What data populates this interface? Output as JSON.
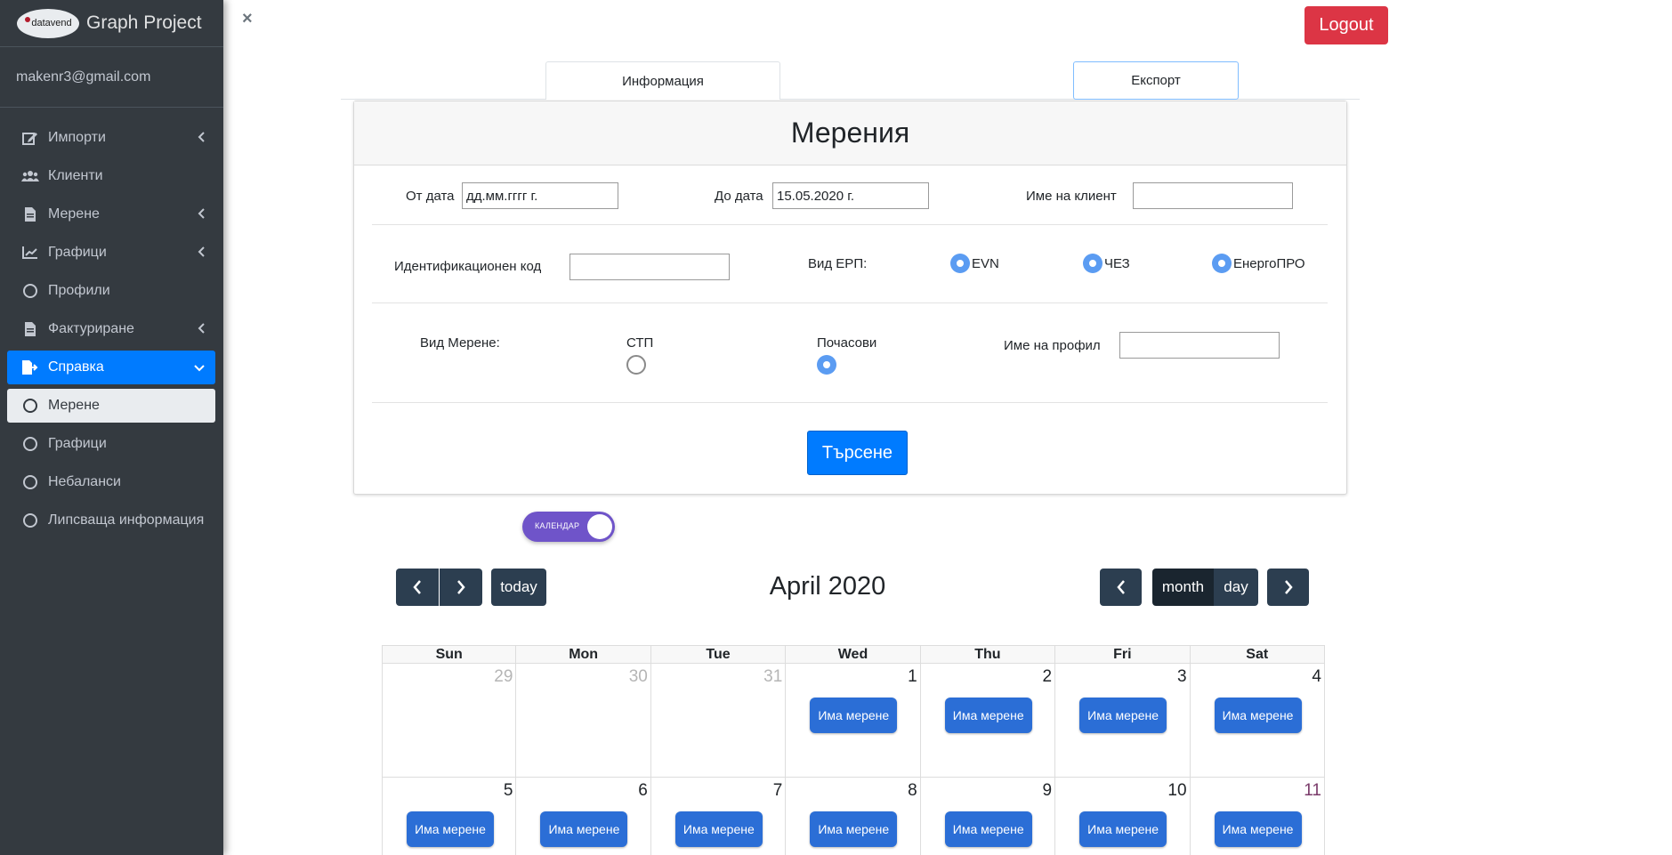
{
  "brand": {
    "logo_text": "datavend",
    "title": "Graph Project"
  },
  "user": {
    "email": "makenr3@gmail.com"
  },
  "sidebar": {
    "items": [
      {
        "label": "Импорти",
        "icon": "edit-icon",
        "has_chevron": true
      },
      {
        "label": "Клиенти",
        "icon": "users-icon",
        "has_chevron": false
      },
      {
        "label": "Мерене",
        "icon": "file-icon",
        "has_chevron": true
      },
      {
        "label": "Графици",
        "icon": "chart-line-icon",
        "has_chevron": true
      },
      {
        "label": "Профили",
        "icon": "circle-icon",
        "has_chevron": false
      },
      {
        "label": "Фактуриране",
        "icon": "file-icon",
        "has_chevron": true
      },
      {
        "label": "Справка",
        "icon": "file-export-icon",
        "has_chevron": true,
        "active": true
      }
    ],
    "subitems": [
      {
        "label": "Мерене",
        "active": true
      },
      {
        "label": "Графици"
      },
      {
        "label": "Небаланси"
      },
      {
        "label": "Липсваща информация"
      }
    ]
  },
  "close_label": "×",
  "logout_label": "Logout",
  "tabs": {
    "info": "Информация",
    "export": "Експорт"
  },
  "card": {
    "title": "Мерения",
    "from_date_label": "От дата",
    "from_date_value": "дд.мм.гггг г.",
    "to_date_label": "До дата",
    "to_date_value": "15.05.2020 г.",
    "client_label": "Име на клиент",
    "client_value": "",
    "id_code_label": "Идентификационен код",
    "id_code_value": "",
    "erp_label": "Вид ЕРП:",
    "erp_options": [
      "EVN",
      "ЧЕЗ",
      "ЕнергоПРО"
    ],
    "metering_label": "Вид Мерене:",
    "metering_options": [
      "СТП",
      "Почасови"
    ],
    "metering_selected": "Почасови",
    "profile_label": "Име на профил",
    "profile_value": "",
    "search_label": "Търсене"
  },
  "toggle": {
    "label": "КАЛЕНДАР",
    "on": true
  },
  "calendar": {
    "title": "April 2020",
    "today_label": "today",
    "month_label": "month",
    "day_label": "day",
    "view_selected": "month",
    "colors": {
      "toolbar": "#2c3e50",
      "event": "#2b6ed6",
      "active_view": "#1a252f"
    },
    "weekdays": [
      "Sun",
      "Mon",
      "Tue",
      "Wed",
      "Thu",
      "Fri",
      "Sat"
    ],
    "event_label": "Има мерене",
    "weeks": [
      [
        {
          "day": "29",
          "other": true,
          "event": false
        },
        {
          "day": "30",
          "other": true,
          "event": false
        },
        {
          "day": "31",
          "other": true,
          "event": false
        },
        {
          "day": "1",
          "other": false,
          "event": true
        },
        {
          "day": "2",
          "other": false,
          "event": true
        },
        {
          "day": "3",
          "other": false,
          "event": true
        },
        {
          "day": "4",
          "other": false,
          "event": true
        }
      ],
      [
        {
          "day": "5",
          "other": false,
          "event": true
        },
        {
          "day": "6",
          "other": false,
          "event": true
        },
        {
          "day": "7",
          "other": false,
          "event": true
        },
        {
          "day": "8",
          "other": false,
          "event": true
        },
        {
          "day": "9",
          "other": false,
          "event": true
        },
        {
          "day": "10",
          "other": false,
          "event": true
        },
        {
          "day": "11",
          "other": false,
          "event": true
        }
      ]
    ]
  }
}
